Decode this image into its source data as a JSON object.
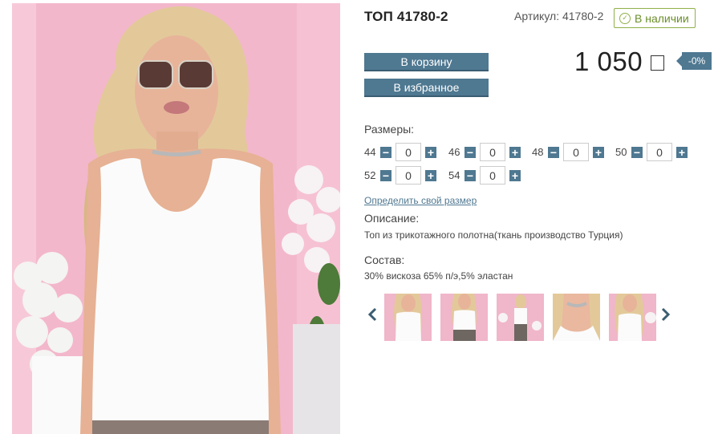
{
  "product": {
    "title": "ТОП 41780-2",
    "article": "Артикул: 41780-2",
    "stock": "В наличии",
    "price": "1 050",
    "discount": "-0%"
  },
  "buttons": {
    "cart": "В корзину",
    "favorites": "В избранное"
  },
  "sizes": {
    "label": "Размеры:",
    "items": [
      {
        "size": "44",
        "qty": "0"
      },
      {
        "size": "46",
        "qty": "0"
      },
      {
        "size": "48",
        "qty": "0"
      },
      {
        "size": "50",
        "qty": "0"
      },
      {
        "size": "52",
        "qty": "0"
      },
      {
        "size": "54",
        "qty": "0"
      }
    ],
    "link": "Определить свой размер"
  },
  "description": {
    "label": "Описание:",
    "text": "Топ из трикотажного полотна(ткань производство Турция)"
  },
  "composition": {
    "label": "Состав:",
    "text": "30% вискоза 65% п/э,5% эластан"
  },
  "icons": {
    "stock": "check-circle-icon",
    "currency": "currency-box-icon",
    "prev": "chevron-left-icon",
    "next": "chevron-right-icon"
  },
  "colors": {
    "accent": "#4f7891",
    "stock": "#8fb04a",
    "background_photo": "#f2b8cc"
  }
}
